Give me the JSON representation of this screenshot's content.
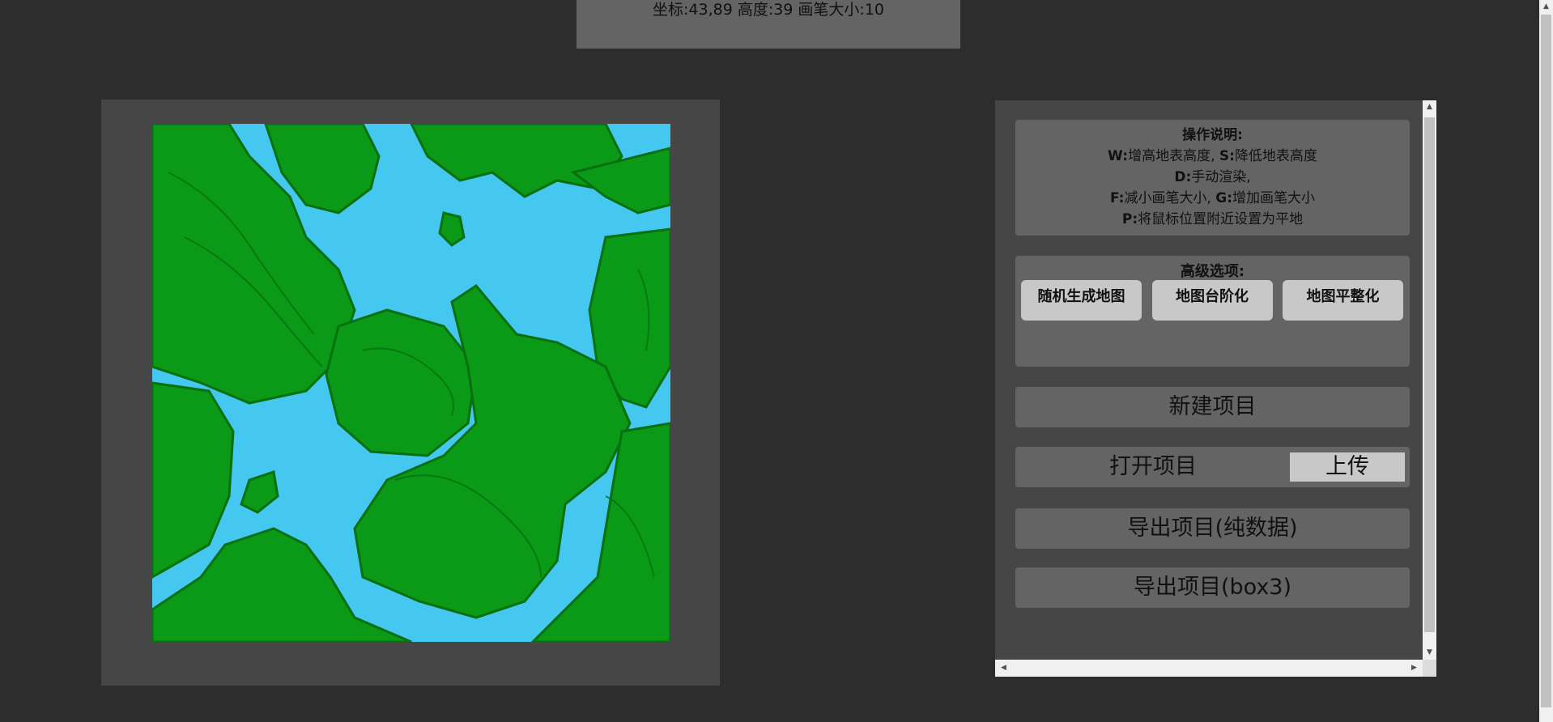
{
  "status": {
    "text": "坐标:43,89 高度:39 画笔大小:10"
  },
  "colors": {
    "water": "#44c8f0",
    "land": "#0a9a18",
    "land_dark": "#067010",
    "frame": "#464646",
    "panel_box": "#646464",
    "button": "#c8c8c8"
  },
  "help": {
    "title": "操作说明:",
    "lines": [
      {
        "key": "W:",
        "text": "增高地表高度, ",
        "key2": "S:",
        "text2": "降低地表高度"
      },
      {
        "key": "D:",
        "text": "手动渲染,"
      },
      {
        "key": "F:",
        "text": "减小画笔大小, ",
        "key2": "G:",
        "text2": "增加画笔大小"
      },
      {
        "key": "P:",
        "text": "将鼠标位置附近设置为平地"
      }
    ]
  },
  "advanced": {
    "title": "高级选项:",
    "buttons": [
      "随机生成地图",
      "地图台阶化",
      "地图平整化"
    ]
  },
  "actions": {
    "new_project": "新建项目",
    "open_project": "打开项目",
    "upload": "上传",
    "export_raw": "导出项目(纯数据)",
    "export_box3": "导出项目(box3)"
  },
  "icons": {
    "scroll_up": "triangle-up-icon",
    "scroll_down": "triangle-down-icon",
    "scroll_left": "triangle-left-icon",
    "scroll_right": "triangle-right-icon"
  }
}
